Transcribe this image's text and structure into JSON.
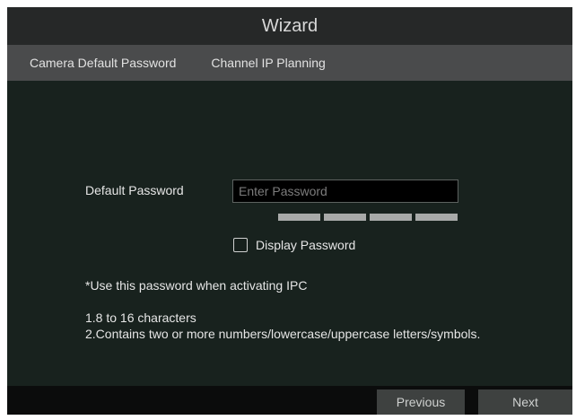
{
  "window": {
    "title": "Wizard"
  },
  "steps": [
    {
      "label": "Camera Default Password"
    },
    {
      "label": "Channel IP Planning"
    }
  ],
  "form": {
    "password_label": "Default Password",
    "password_placeholder": "Enter Password",
    "password_value": "",
    "strength_segments": 4,
    "display_password_label": "Display Password",
    "display_password_checked": false,
    "note": "*Use this password when activating IPC",
    "rule_1": "1.8 to 16 characters",
    "rule_2": "2.Contains two or more numbers/lowercase/uppercase letters/symbols."
  },
  "footer": {
    "previous_label": "Previous",
    "next_label": "Next"
  },
  "colors": {
    "background": "#18221e",
    "titlebar": "#262828",
    "steps_bar": "#4a4b4c",
    "button": "#3e4140",
    "strength_bar": "#a8aaa9"
  }
}
